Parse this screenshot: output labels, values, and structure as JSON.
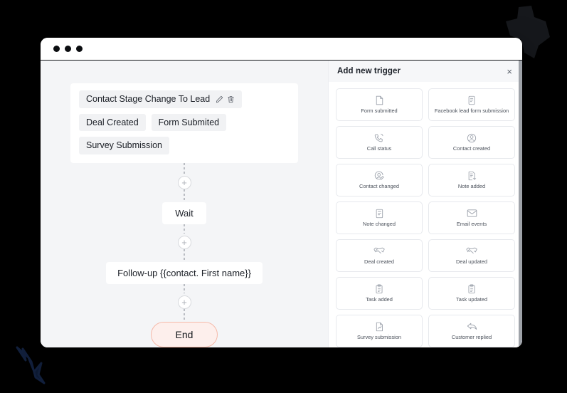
{
  "window": {
    "dots_count": 3
  },
  "canvas": {
    "trigger_card": {
      "chips": [
        {
          "label": "Contact Stage Change To Lead",
          "has_actions": true
        },
        {
          "label": "Deal Created",
          "has_actions": false
        },
        {
          "label": "Form Submited",
          "has_actions": false
        },
        {
          "label": "Survey Submission",
          "has_actions": false
        }
      ]
    },
    "nodes": [
      {
        "label": "Wait",
        "type": "step"
      },
      {
        "label": "Follow-up {{contact. First name}}",
        "type": "step"
      },
      {
        "label": "End",
        "type": "end"
      }
    ],
    "add_node_symbol": "+"
  },
  "panel": {
    "title": "Add new trigger",
    "close_symbol": "×",
    "triggers": [
      {
        "label": "Form submitted",
        "icon": "file-icon"
      },
      {
        "label": "Facebook lead form submission",
        "icon": "form-icon"
      },
      {
        "label": "Call status",
        "icon": "phone-icon"
      },
      {
        "label": "Contact created",
        "icon": "user-circle-icon"
      },
      {
        "label": "Contact changed",
        "icon": "user-edit-icon"
      },
      {
        "label": "Note added",
        "icon": "note-plus-icon"
      },
      {
        "label": "Note changed",
        "icon": "note-icon"
      },
      {
        "label": "Email events",
        "icon": "envelope-icon"
      },
      {
        "label": "Deal created",
        "icon": "handshake-icon"
      },
      {
        "label": "Deal updated",
        "icon": "handshake-icon"
      },
      {
        "label": "Task added",
        "icon": "clipboard-icon"
      },
      {
        "label": "Task updated",
        "icon": "clipboard-icon"
      },
      {
        "label": "Survey submission",
        "icon": "survey-icon"
      },
      {
        "label": "Customer replied",
        "icon": "reply-icon"
      }
    ]
  },
  "colors": {
    "page_background": "#000000",
    "canvas_background": "#f4f5f7",
    "panel_background": "#ffffff",
    "end_node_fill": "#fdefec",
    "end_node_border": "#f5b9a9",
    "chip_background": "#f1f2f4"
  }
}
